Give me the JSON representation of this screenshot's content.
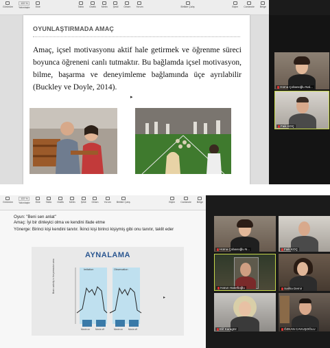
{
  "screen1": {
    "toolbar": {
      "left_item": "Görünüm",
      "zoom_value": "122 %",
      "zoom_label": "Yakınlaştır",
      "items": [
        "Ekle",
        "Tablo",
        "Grafik",
        "Metin",
        "Şekil",
        "Ortam",
        "Yorum"
      ],
      "center": "Birlikte Çalış",
      "right_items": [
        "Biçim",
        "Canlandır",
        "Belge"
      ]
    },
    "slide": {
      "title": "OYUNLAŞTIRMADA AMAÇ",
      "body": "Amaç, içsel motivasyonu aktif hale getirmek ve öğrenme süreci boyunca öğreneni canlı tutmaktır. Bu bağlamda içsel motivasyon, bilme, başarma ve deneyimleme bağlamında üçe ayrılabilir (Buckley ve Doyle, 2014).",
      "photo_a_desc": "teacher-and-students-photo",
      "photo_b_desc": "children-outdoor-game-photo"
    },
    "participants": [
      {
        "name": "Hüma Çobanoğlu Nal..."
      },
      {
        "name": "Faik KOÇ"
      }
    ]
  },
  "screen2": {
    "toolbar": {
      "left_item": "Görünüm",
      "zoom_value": "122 %",
      "zoom_label": "Yakınlaştır",
      "items": [
        "Ekle",
        "Tablo",
        "Grafik",
        "Metin",
        "Şekil",
        "Ortam",
        "Yorum"
      ],
      "center": "Birlikte Çalış",
      "right_items": [
        "Biçim",
        "Canlandır",
        "Belge"
      ]
    },
    "notes": [
      "Oyun: \"Beni sen anlat\"",
      "Amaç: İyi bir dinleyici olma ve kendini ifade etme",
      "Yönerge: Birinci kişi kendini tanıtır. İkinci kişi birinci kişiymiş gibi onu tanıtır, taklit eder"
    ],
    "slide_title": "AYNALAMA",
    "chart_labels": {
      "left_panel": "Imitation",
      "right_panel": "Observation",
      "y_axis": "Brain activity in the premotor area",
      "stim1": "Movie on",
      "stim2": "Movie off"
    },
    "participants": [
      {
        "name": "Hüma Çobanoğlu N..."
      },
      {
        "name": "Faik KOÇ"
      },
      {
        "name": "Harun Hanefioğlu"
      },
      {
        "name": "Saliha Demir"
      },
      {
        "name": "Elif Karagöz"
      },
      {
        "name": "ÖZKAN CAVUŞOĞLU"
      }
    ]
  },
  "colors": {
    "highlight_border": "#c7d84a",
    "slide_title_blue": "#2a5690",
    "mic_muted": "#dd3333"
  }
}
